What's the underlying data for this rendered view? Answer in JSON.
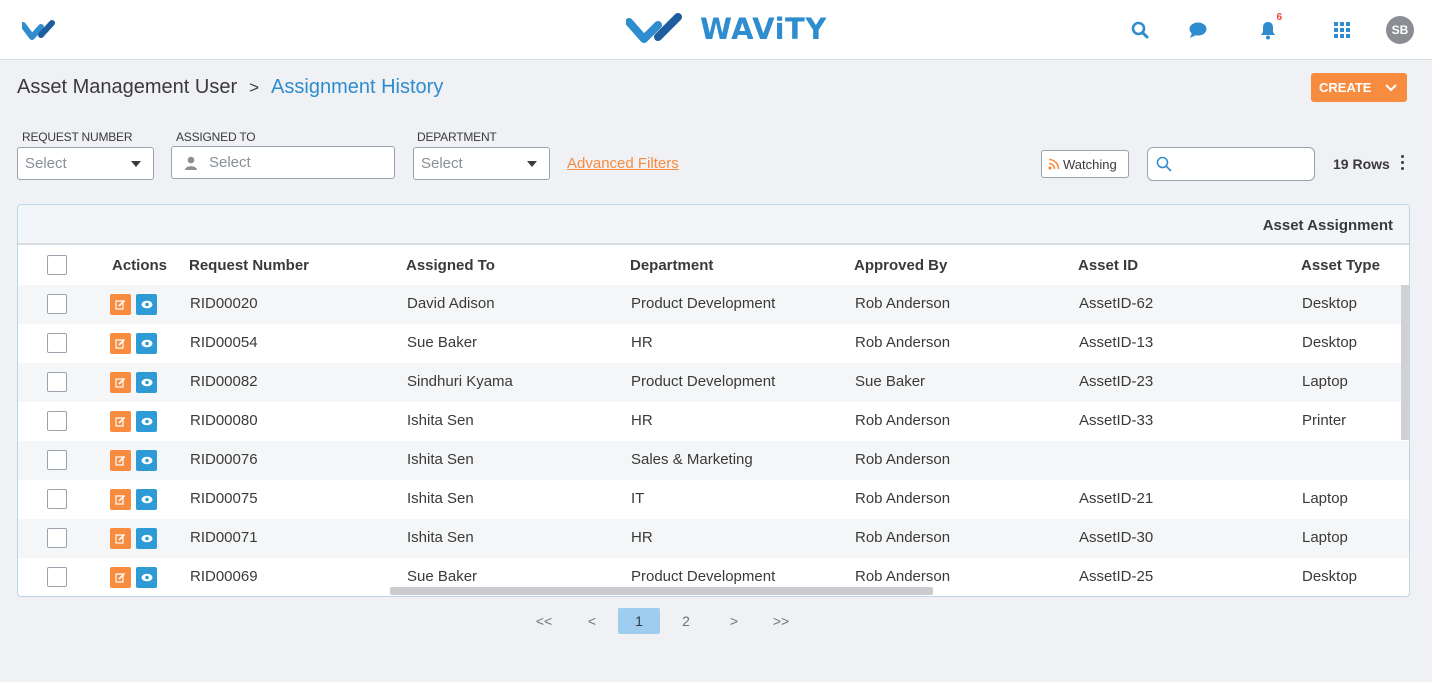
{
  "header": {
    "brand": "WAViTY",
    "notification_count": "6",
    "avatar_initials": "SB",
    "icons": [
      "search-icon",
      "chat-icon",
      "bell-icon",
      "apps-grid-icon"
    ],
    "accent_color": "#2e8ccf"
  },
  "breadcrumb": {
    "root": "Asset Management User",
    "separator": ">",
    "current": "Assignment History"
  },
  "create_button": {
    "label": "CREATE",
    "color": "#f78c40"
  },
  "filters": {
    "request_number": {
      "label": "REQUEST NUMBER",
      "placeholder": "Select"
    },
    "assigned_to": {
      "label": "ASSIGNED TO",
      "placeholder": "Select"
    },
    "department": {
      "label": "DEPARTMENT",
      "placeholder": "Select"
    },
    "advanced_label": "Advanced Filters"
  },
  "toolbar": {
    "watching_label": "Watching",
    "search_value": "",
    "rows_count": "19 Rows"
  },
  "table": {
    "group_title": "Asset Assignment",
    "columns": [
      "Actions",
      "Request Number",
      "Assigned To",
      "Department",
      "Approved By",
      "Asset ID",
      "Asset Type"
    ],
    "rows": [
      [
        "RID00020",
        "David Adison",
        "Product Development",
        "Rob Anderson",
        "AssetID-62",
        "Desktop"
      ],
      [
        "RID00054",
        "Sue Baker",
        "HR",
        "Rob Anderson",
        "AssetID-13",
        "Desktop"
      ],
      [
        "RID00082",
        "Sindhuri Kyama",
        "Product Development",
        "Sue Baker",
        "AssetID-23",
        "Laptop"
      ],
      [
        "RID00080",
        "Ishita Sen",
        "HR",
        "Rob Anderson",
        "AssetID-33",
        "Printer"
      ],
      [
        "RID00076",
        "Ishita Sen",
        "Sales & Marketing",
        "Rob Anderson",
        "",
        ""
      ],
      [
        "RID00075",
        "Ishita Sen",
        "IT",
        "Rob Anderson",
        "AssetID-21",
        "Laptop"
      ],
      [
        "RID00071",
        "Ishita Sen",
        "HR",
        "Rob Anderson",
        "AssetID-30",
        "Laptop"
      ],
      [
        "RID00069",
        "Sue Baker",
        "Product Development",
        "Rob Anderson",
        "AssetID-25",
        "Desktop"
      ]
    ]
  },
  "pagination": {
    "first": "<<",
    "prev": "<",
    "pages": [
      "1",
      "2"
    ],
    "current": "1",
    "next": ">",
    "last": ">>"
  }
}
